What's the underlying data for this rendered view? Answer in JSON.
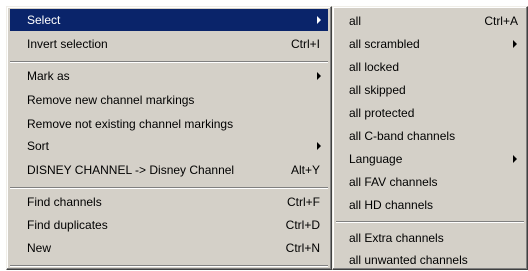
{
  "main_menu": {
    "items": [
      {
        "label": "Select",
        "shortcut": "",
        "submenu": true,
        "highlighted": true
      },
      {
        "label": "Invert selection",
        "shortcut": "Ctrl+I"
      },
      {
        "label": "Mark as",
        "shortcut": "",
        "submenu": true
      },
      {
        "label": "Remove new channel markings",
        "shortcut": ""
      },
      {
        "label": "Remove not existing channel markings",
        "shortcut": ""
      },
      {
        "label": "Sort",
        "shortcut": "",
        "submenu": true
      },
      {
        "label": "DISNEY CHANNEL -> Disney Channel",
        "shortcut": "Alt+Y"
      },
      {
        "label": "Find channels",
        "shortcut": "Ctrl+F"
      },
      {
        "label": "Find duplicates",
        "shortcut": "Ctrl+D"
      },
      {
        "label": "New",
        "shortcut": "Ctrl+N"
      }
    ]
  },
  "sub_menu": {
    "items": [
      {
        "label": "all",
        "shortcut": "Ctrl+A"
      },
      {
        "label": "all scrambled",
        "shortcut": "",
        "submenu": true
      },
      {
        "label": "all locked",
        "shortcut": ""
      },
      {
        "label": "all skipped",
        "shortcut": ""
      },
      {
        "label": "all protected",
        "shortcut": ""
      },
      {
        "label": "all C-band channels",
        "shortcut": ""
      },
      {
        "label": "Language",
        "shortcut": "",
        "submenu": true
      },
      {
        "label": "all FAV channels",
        "shortcut": ""
      },
      {
        "label": "all HD channels",
        "shortcut": ""
      },
      {
        "label": "all Extra channels",
        "shortcut": ""
      },
      {
        "label": "all unwanted channels",
        "shortcut": ""
      }
    ]
  },
  "colors": {
    "menu_bg": "#d4d0c8",
    "highlight": "#0a246a",
    "highlight_text": "#ffffff"
  }
}
